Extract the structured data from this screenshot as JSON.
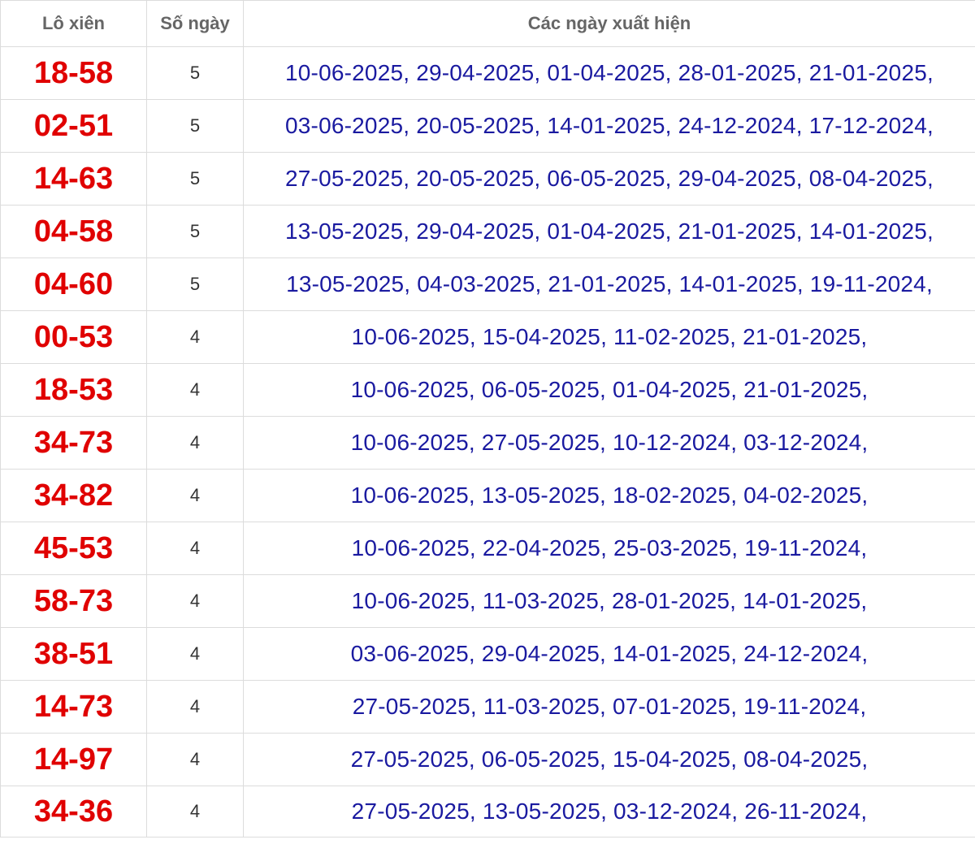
{
  "header": {
    "col_pair": "Lô xiên",
    "col_count": "Số ngày",
    "col_dates": "Các ngày xuất hiện"
  },
  "rows": [
    {
      "pair": "18-58",
      "count": "5",
      "dates": "10-06-2025, 29-04-2025, 01-04-2025, 28-01-2025, 21-01-2025,"
    },
    {
      "pair": "02-51",
      "count": "5",
      "dates": "03-06-2025, 20-05-2025, 14-01-2025, 24-12-2024, 17-12-2024,"
    },
    {
      "pair": "14-63",
      "count": "5",
      "dates": "27-05-2025, 20-05-2025, 06-05-2025, 29-04-2025, 08-04-2025,"
    },
    {
      "pair": "04-58",
      "count": "5",
      "dates": "13-05-2025, 29-04-2025, 01-04-2025, 21-01-2025, 14-01-2025,"
    },
    {
      "pair": "04-60",
      "count": "5",
      "dates": "13-05-2025, 04-03-2025, 21-01-2025, 14-01-2025, 19-11-2024,"
    },
    {
      "pair": "00-53",
      "count": "4",
      "dates": "10-06-2025, 15-04-2025, 11-02-2025, 21-01-2025,"
    },
    {
      "pair": "18-53",
      "count": "4",
      "dates": "10-06-2025, 06-05-2025, 01-04-2025, 21-01-2025,"
    },
    {
      "pair": "34-73",
      "count": "4",
      "dates": "10-06-2025, 27-05-2025, 10-12-2024, 03-12-2024,"
    },
    {
      "pair": "34-82",
      "count": "4",
      "dates": "10-06-2025, 13-05-2025, 18-02-2025, 04-02-2025,"
    },
    {
      "pair": "45-53",
      "count": "4",
      "dates": "10-06-2025, 22-04-2025, 25-03-2025, 19-11-2024,"
    },
    {
      "pair": "58-73",
      "count": "4",
      "dates": "10-06-2025, 11-03-2025, 28-01-2025, 14-01-2025,"
    },
    {
      "pair": "38-51",
      "count": "4",
      "dates": "03-06-2025, 29-04-2025, 14-01-2025, 24-12-2024,"
    },
    {
      "pair": "14-73",
      "count": "4",
      "dates": "27-05-2025, 11-03-2025, 07-01-2025, 19-11-2024,"
    },
    {
      "pair": "14-97",
      "count": "4",
      "dates": "27-05-2025, 06-05-2025, 15-04-2025, 08-04-2025,"
    },
    {
      "pair": "34-36",
      "count": "4",
      "dates": "27-05-2025, 13-05-2025, 03-12-2024, 26-11-2024,"
    }
  ],
  "colors": {
    "pair": "#e00000",
    "dates": "#1a1aa0",
    "header": "#666666",
    "border": "#dcdcdc"
  }
}
